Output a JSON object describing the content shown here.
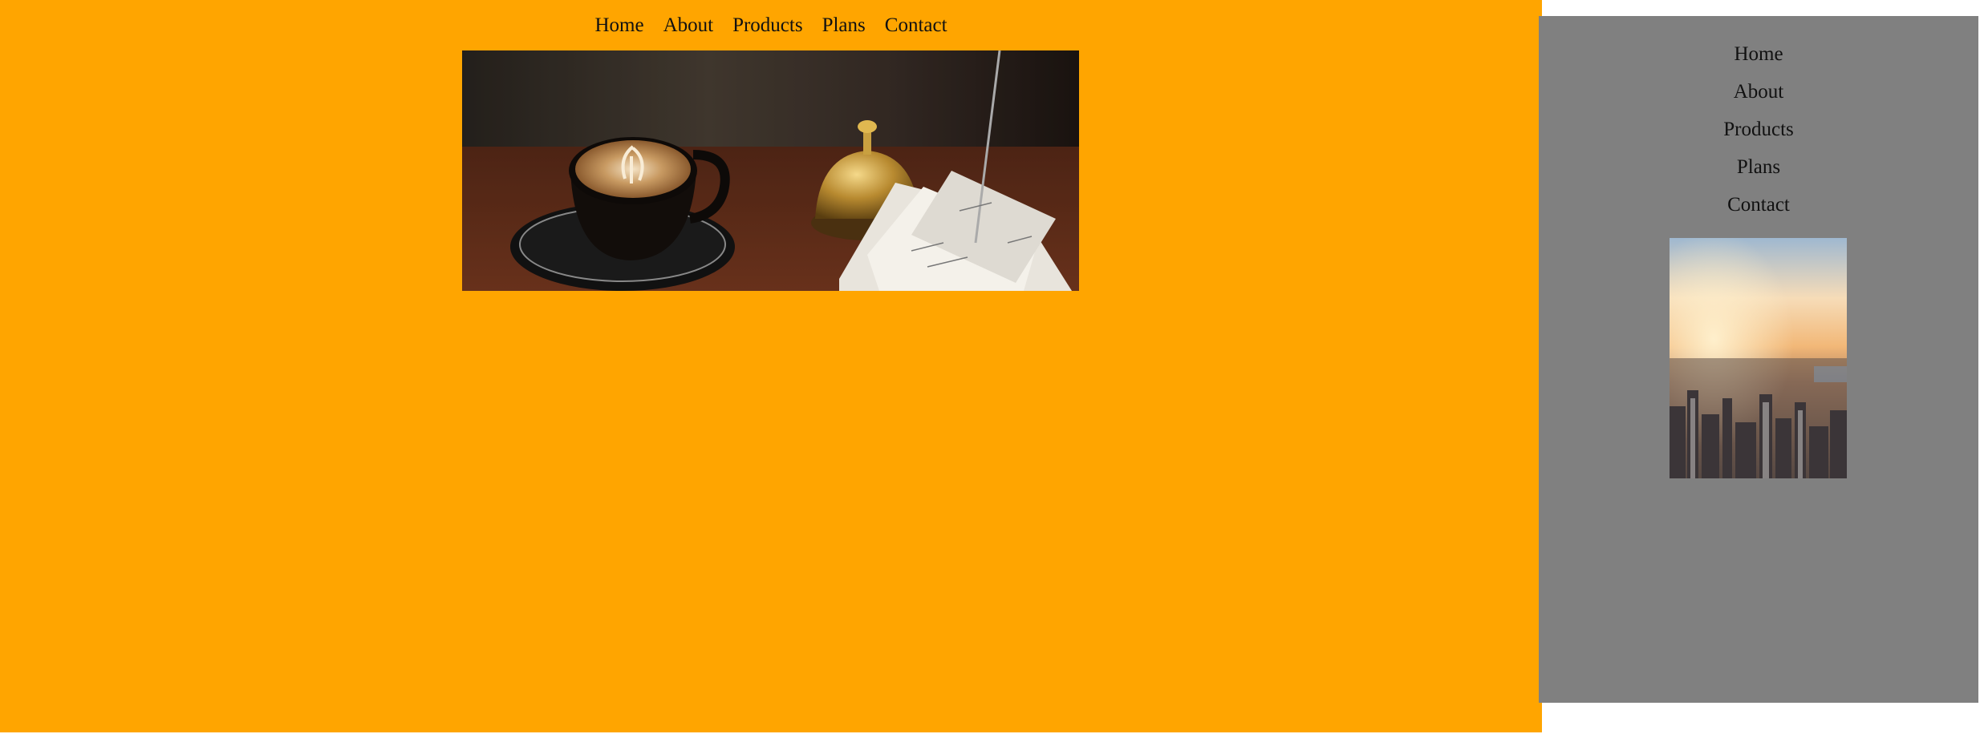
{
  "top_nav": {
    "items": [
      "Home",
      "About",
      "Products",
      "Plans",
      "Contact"
    ]
  },
  "side_nav": {
    "items": [
      "Home",
      "About",
      "Products",
      "Plans",
      "Contact"
    ]
  },
  "hero_image": {
    "subject": "latte art coffee cup with brass bell and receipts"
  },
  "side_image": {
    "subject": "aerial city skyline at sunset"
  },
  "colors": {
    "main_background": "#ffa500",
    "sidebar_background": "#808080",
    "page_background": "#ffffff",
    "nav_text": "#111111"
  }
}
